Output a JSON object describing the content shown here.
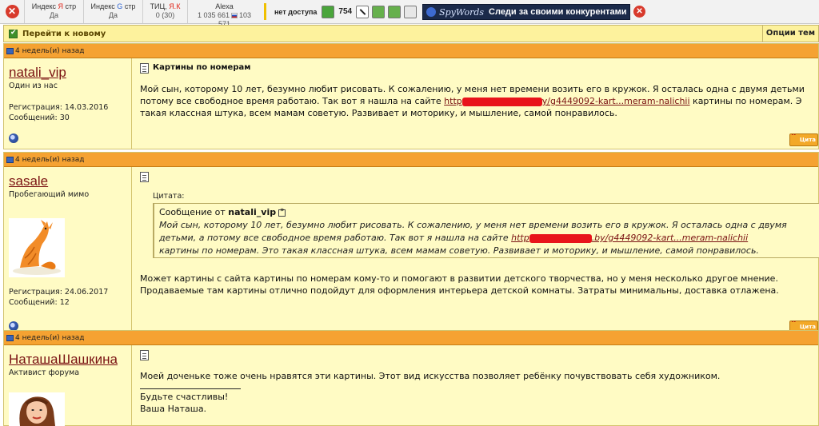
{
  "seo_bar": {
    "yandex": {
      "prefix": "Индекс ",
      "engine": "Я",
      "suffix": " стр",
      "value": "Да"
    },
    "google": {
      "prefix": "Индекс ",
      "engine": "G",
      "suffix": " стр",
      "value": "Да"
    },
    "tic": {
      "prefix": "ТИЦ, ",
      "engine": "Я.К",
      "value": "0 (30)"
    },
    "alexa": {
      "label": "Alexa",
      "global_rank": "1 035 661",
      "country_rank": "103 571"
    },
    "status": "нет доступа",
    "count": "754",
    "spywords": {
      "logo": "SpyWords",
      "text": "Следи за своими конкурентами"
    }
  },
  "forum": {
    "jump_new": "Перейти к новому",
    "options": "Опции тем",
    "colors": {
      "header": "#f5a232",
      "post_bg": "#fffbc4",
      "topbar": "#fdf29d",
      "username": "#7a1212"
    },
    "posts": [
      {
        "date": "4 недель(и) назад",
        "author": "natali_vip",
        "role": "Один из нас",
        "registered": "Регистрация: 14.03.2016",
        "messages": "Сообщений: 30",
        "title": "Картины по номерам",
        "lines": [
          "Мой сын, которому 10 лет, безумно любит рисовать. К сожалению, у меня нет времени возить его в кружок. Я осталась одна с двумя детьми",
          "потому все свободное время работаю. Так вот я нашла на сайте ",
          "такая классная штука, всем мамам советую. Развивает и моторику, и мышление, самой понравилось."
        ],
        "link_start": "http",
        "link_end": "y/g4449092-kart...meram-nalichii",
        "line2_tail": " картины по номерам. Э"
      },
      {
        "date": "4 недель(и) назад",
        "author": "sasale",
        "role": "Пробегающий мимо",
        "registered": "Регистрация: 24.06.2017",
        "messages": "Сообщений: 12",
        "quote_label": "Цитата:",
        "quote_from_prefix": "Сообщение от ",
        "quote_from_author": "natali_vip",
        "quote_lines": [
          "Мой сын, которому 10 лет, безумно любит рисовать. К сожалению, у меня нет времени возить его в кружок. Я осталась одна с двумя",
          "детьми, а потому все свободное время работаю. Так вот я нашла на сайте ",
          "картины по номерам. Это такая классная штука, всем мамам советую. Развивает и моторику, и мышление, самой понравилось."
        ],
        "quote_link_start": "http",
        "quote_link_end": ".by/g4449092-kart...meram-nalichii",
        "lines": [
          "Может картины с сайта картины по номерам кому-то и помогают в развитии детского творчества, но у меня несколько другое мнение.",
          "Продаваемые там картины отлично подойдут для оформления интерьера детской комнаты. Затраты минимальны, доставка отлажена."
        ]
      },
      {
        "date": "4 недель(и) назад",
        "author": "НаташаШашкина",
        "role": "Активист форума",
        "lines": [
          "Моей доченьке тоже очень нравятся эти картины. Этот вид искусства позволяет ребёнку почувствовать себя художником."
        ],
        "signature": [
          "Будьте счастливы!",
          "Ваша Наташа."
        ]
      }
    ],
    "quote_button": "Цита"
  }
}
